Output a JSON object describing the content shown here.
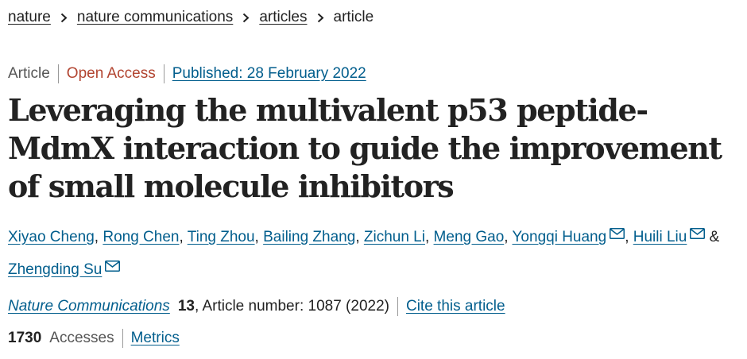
{
  "breadcrumb": {
    "items": [
      "nature",
      "nature communications",
      "articles"
    ],
    "current": "article"
  },
  "meta": {
    "type": "Article",
    "access": "Open Access",
    "published": "Published: 28 February 2022"
  },
  "title": "Leveraging the multivalent p53 peptide-MdmX interaction to guide the improvement of small molecule inhibitors",
  "authors": {
    "names": [
      "Xiyao Cheng",
      "Rong Chen",
      "Ting Zhou",
      "Bailing Zhang",
      "Zichun Li",
      "Meng Gao",
      "Yongqi Huang",
      "Huili Liu",
      "Zhengding Su"
    ],
    "separator": ", ",
    "conjunction": " & "
  },
  "citation": {
    "journal": "Nature Communications",
    "volume": "13",
    "article_number": ", Article number: 1087 (2022)",
    "cite_link": "Cite this article"
  },
  "metrics": {
    "accesses_count": "1730",
    "accesses_label": "Accesses",
    "metrics_link": "Metrics"
  },
  "colors": {
    "link": "#025e8d",
    "open_access": "#b24531",
    "text": "#222222",
    "muted": "#555555"
  },
  "icons": {
    "breadcrumb_separator": "chevron-right-icon",
    "author_contact": "envelope-icon"
  }
}
